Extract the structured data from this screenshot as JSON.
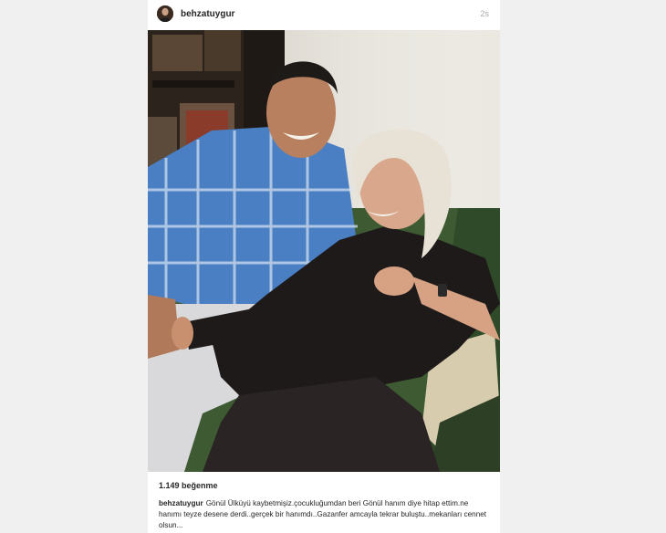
{
  "post": {
    "username": "behzatuygur",
    "timestamp": "2s",
    "likes": "1.149 beğenme",
    "caption_user": "behzatuygur",
    "caption_text": "Gönül Ülküyü kaybetmişiz.çocukluğumdan beri Gönül hanım diye hitap ettim.ne hanımı teyze desene derdi..gerçek bir hanımdı..Gazanfer amcayla tekrar buluştu..mekanları cennet olsun..."
  }
}
